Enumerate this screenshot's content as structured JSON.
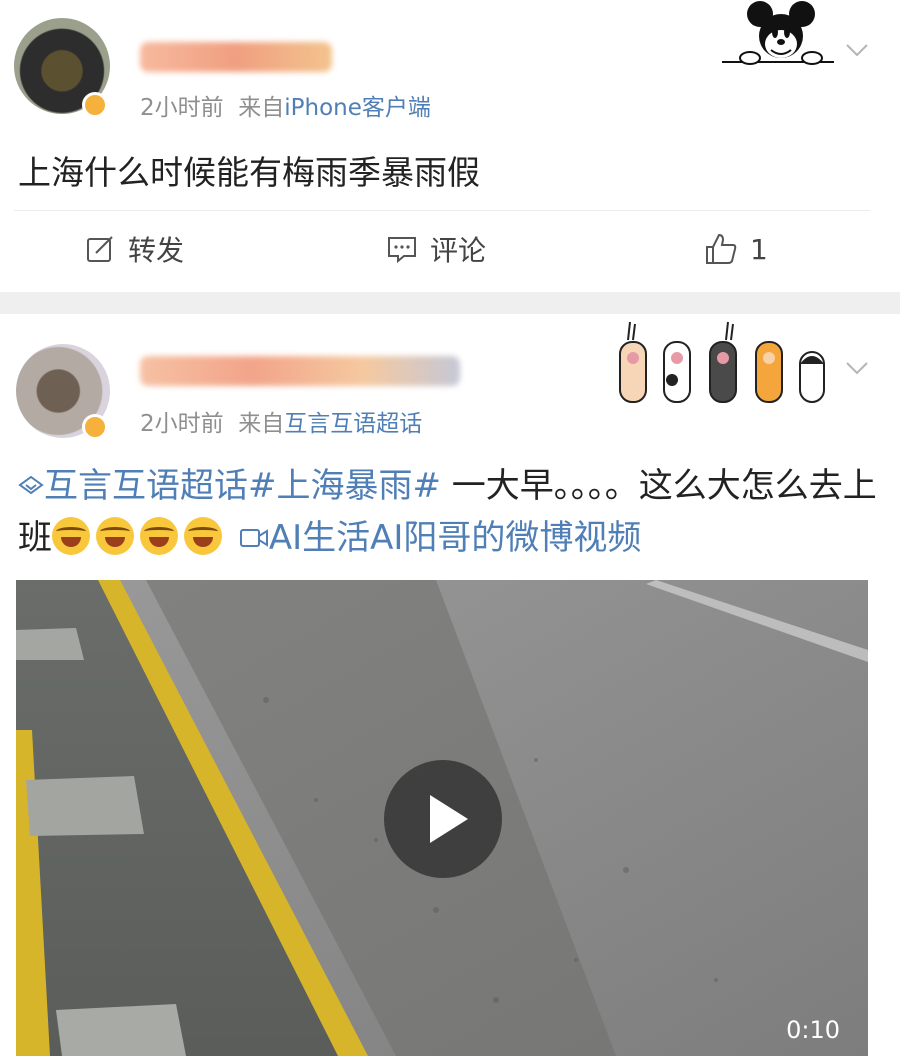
{
  "posts": [
    {
      "time": "2小时前",
      "from_label": "来自",
      "source": "iPhone客户端",
      "text": "上海什么时候能有梅雨季暴雨假",
      "actions": {
        "repost": "转发",
        "comment": "评论",
        "like_count": "1"
      }
    },
    {
      "time": "2小时前",
      "from_label": "来自",
      "source": "互言互语超话",
      "topic_link": "互言互语超话",
      "hashtag": "#上海暴雨#",
      "text": " 一大早。。。。这么大怎么去上班",
      "video_link": "AI生活AI阳哥的微博视频",
      "video": {
        "duration": "0:10"
      }
    }
  ],
  "colors": {
    "link": "#4f7fb6",
    "meta": "#8f8f8f",
    "separator": "#efefef",
    "badge": "#f6b13c"
  }
}
